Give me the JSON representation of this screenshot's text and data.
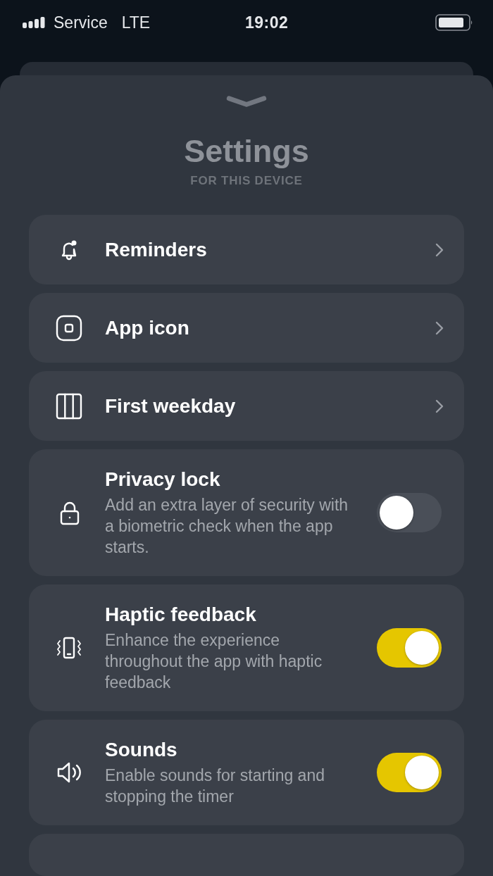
{
  "status_bar": {
    "carrier": "Service",
    "network": "LTE",
    "time": "19:02"
  },
  "header": {
    "title": "Settings",
    "subtitle": "FOR THIS DEVICE"
  },
  "items": [
    {
      "kind": "link",
      "label": "Reminders"
    },
    {
      "kind": "link",
      "label": "App icon"
    },
    {
      "kind": "link",
      "label": "First weekday"
    },
    {
      "kind": "toggle",
      "label": "Privacy lock",
      "description": "Add an extra layer of security with a biometric check when the app starts.",
      "on": false
    },
    {
      "kind": "toggle",
      "label": "Haptic feedback",
      "description": "Enhance the experience throughout the app with haptic feedback",
      "on": true
    },
    {
      "kind": "toggle",
      "label": "Sounds",
      "description": "Enable sounds for starting and stopping the timer",
      "on": true
    }
  ]
}
